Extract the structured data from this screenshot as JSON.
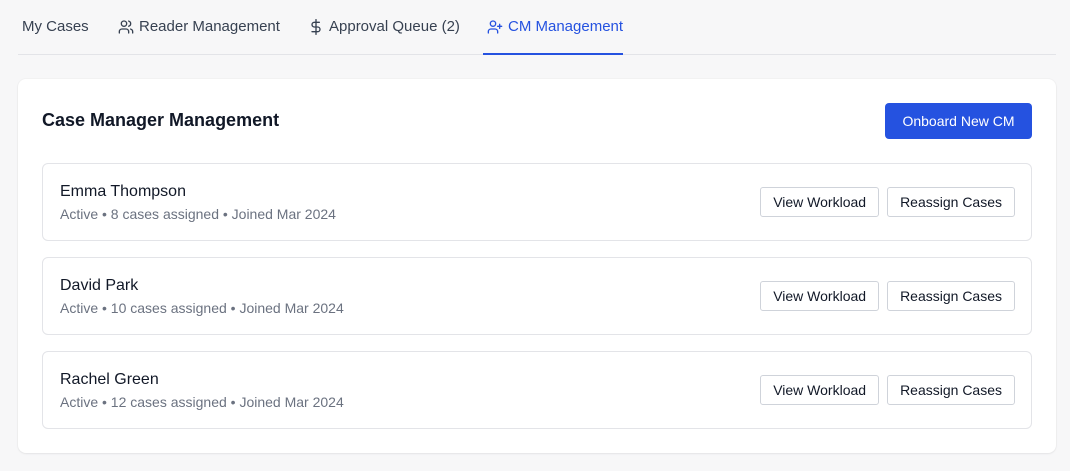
{
  "tabs": {
    "my_cases": {
      "label": "My Cases"
    },
    "reader_management": {
      "label": "Reader Management",
      "icon": "users-icon"
    },
    "approval_queue": {
      "label": "Approval Queue (2)",
      "icon": "dollar-icon"
    },
    "cm_management": {
      "label": "CM Management",
      "icon": "user-plus-icon",
      "active": true
    }
  },
  "colors": {
    "accent": "#2552e0",
    "muted_text": "#6b7280",
    "border": "#e3e4e8",
    "background": "#f7f7f8"
  },
  "main": {
    "title": "Case Manager Management",
    "onboard_button": "Onboard New CM",
    "case_managers": [
      {
        "name": "Emma Thompson",
        "status": "Active",
        "cases": "8 cases assigned",
        "joined": "Joined Mar 2024",
        "meta": "Active • 8 cases assigned • Joined Mar 2024",
        "view_label": "View Workload",
        "reassign_label": "Reassign Cases"
      },
      {
        "name": "David Park",
        "status": "Active",
        "cases": "10 cases assigned",
        "joined": "Joined Mar 2024",
        "meta": "Active • 10 cases assigned • Joined Mar 2024",
        "view_label": "View Workload",
        "reassign_label": "Reassign Cases"
      },
      {
        "name": "Rachel Green",
        "status": "Active",
        "cases": "12 cases assigned",
        "joined": "Joined Mar 2024",
        "meta": "Active • 12 cases assigned • Joined Mar 2024",
        "view_label": "View Workload",
        "reassign_label": "Reassign Cases"
      }
    ]
  }
}
